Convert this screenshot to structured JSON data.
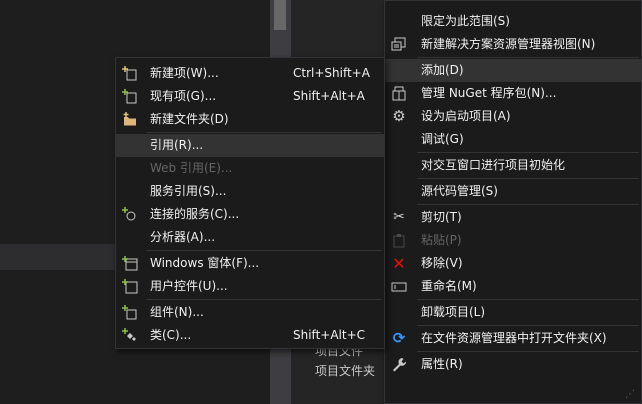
{
  "background": {
    "project_file_1": "项目文件",
    "project_file_2": "项目文件夹"
  },
  "right_menu": {
    "items": [
      {
        "label": "限定为此范围(S)",
        "icon": ""
      },
      {
        "label": "新建解决方案资源管理器视图(N)",
        "icon": "new-view-icon"
      },
      {
        "label": "添加(D)",
        "icon": "",
        "highlighted": true
      },
      {
        "label": "管理 NuGet 程序包(N)...",
        "icon": "nuget-package-icon"
      },
      {
        "label": "设为启动项目(A)",
        "icon": "gear-icon"
      },
      {
        "label": "调试(G)",
        "icon": ""
      },
      {
        "label": "对交互窗口进行项目初始化",
        "icon": ""
      },
      {
        "label": "源代码管理(S)",
        "icon": ""
      },
      {
        "label": "剪切(T)",
        "icon": "scissors-icon"
      },
      {
        "label": "粘贴(P)",
        "icon": "paste-icon",
        "disabled": true
      },
      {
        "label": "移除(V)",
        "icon": "red-x-icon"
      },
      {
        "label": "重命名(M)",
        "icon": "rename-icon"
      },
      {
        "label": "卸载项目(L)",
        "icon": ""
      },
      {
        "label": "在文件资源管理器中打开文件夹(X)",
        "icon": "refresh-arrow-icon"
      },
      {
        "label": "属性(R)",
        "icon": "wrench-icon"
      }
    ]
  },
  "add_submenu": {
    "items": [
      {
        "label": "新建项(W)...",
        "shortcut": "Ctrl+Shift+A",
        "icon": "new-item-icon"
      },
      {
        "label": "现有项(G)...",
        "shortcut": "Shift+Alt+A",
        "icon": "existing-item-icon"
      },
      {
        "label": "新建文件夹(D)",
        "shortcut": "",
        "icon": "new-folder-icon"
      },
      {
        "label": "引用(R)...",
        "shortcut": "",
        "icon": "",
        "highlighted": true
      },
      {
        "label": "Web 引用(E)...",
        "shortcut": "",
        "icon": "",
        "disabled": true
      },
      {
        "label": "服务引用(S)...",
        "shortcut": "",
        "icon": ""
      },
      {
        "label": "连接的服务(C)...",
        "shortcut": "",
        "icon": "connected-service-icon"
      },
      {
        "label": "分析器(A)...",
        "shortcut": "",
        "icon": ""
      },
      {
        "label": "Windows 窗体(F)...",
        "shortcut": "",
        "icon": "windows-form-icon"
      },
      {
        "label": "用户控件(U)...",
        "shortcut": "",
        "icon": "user-control-icon"
      },
      {
        "label": "组件(N)...",
        "shortcut": "",
        "icon": "component-icon"
      },
      {
        "label": "类(C)...",
        "shortcut": "Shift+Alt+C",
        "icon": "class-icon"
      }
    ]
  },
  "colors": {
    "menu_bg": "#1b1b1c",
    "highlight": "#333334",
    "text": "#f1f1f1",
    "disabled_text": "#656565",
    "accent_blue": "#3794ff",
    "remove_red": "#e51400",
    "icon_green": "#8bc34a"
  }
}
